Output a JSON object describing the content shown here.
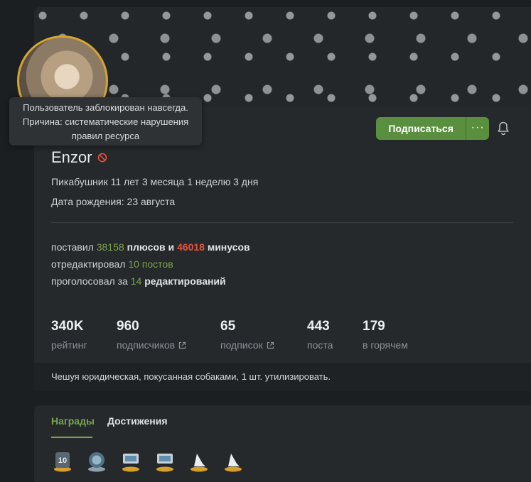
{
  "tooltip": {
    "line1": "Пользователь заблокирован навсегда.",
    "line2": "Причина: систематические нарушения",
    "line3": "правил ресурса"
  },
  "profile": {
    "username": "Enzor",
    "tenure": "Пикабушник 11 лет 3 месяца 1 неделю 3 дня",
    "birthday": "Дата рождения: 23 августа"
  },
  "actions": {
    "subscribe_label": "Подписаться",
    "more_label": "···"
  },
  "activity": {
    "put_prefix": "поставил",
    "plus_count": "38158",
    "plus_word": "плюсов и",
    "minus_count": "46018",
    "minus_word": "минусов",
    "edited_prefix": "отредактировал",
    "edited_value": "10 постов",
    "voted_prefix": "проголосовал за",
    "voted_count": "14",
    "voted_word": "редактирований"
  },
  "counters": [
    {
      "value": "340K",
      "label": "рейтинг"
    },
    {
      "value": "960",
      "label": "подписчиков"
    },
    {
      "value": "65",
      "label": "подписок"
    },
    {
      "value": "443",
      "label": "поста"
    },
    {
      "value": "179",
      "label": "в горячем"
    }
  ],
  "bio": "Чешуя юридическая, покусанная собаками, 1 шт. утилизировать.",
  "tabs": {
    "awards": "Награды",
    "achievements": "Достижения"
  },
  "colors": {
    "accent_green": "#5a8f3f",
    "minus_red": "#e5533d",
    "avatar_ring": "#d4a531"
  }
}
